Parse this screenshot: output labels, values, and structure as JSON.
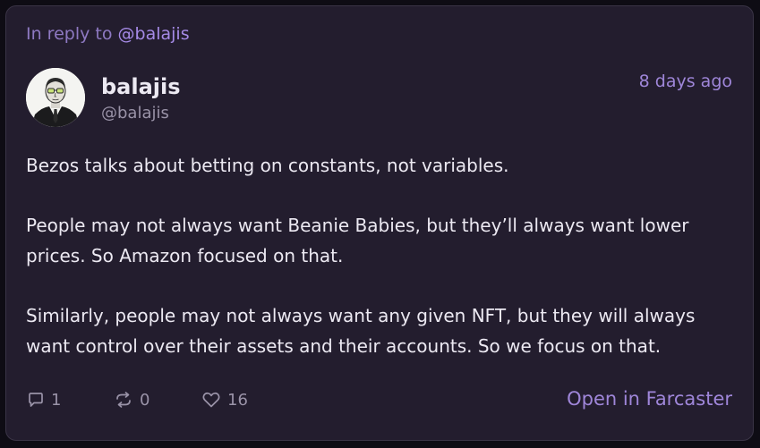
{
  "reply": {
    "prefix": "In reply to",
    "handle": "@balajis"
  },
  "author": {
    "display_name": "balajis",
    "handle": "@balajis",
    "avatar_icon": "portrait-avatar"
  },
  "post": {
    "timestamp": "8 days ago",
    "paragraphs": [
      [
        "Bezos talks about betting on constants, not variables."
      ],
      [
        "People may not always want Beanie Babies, but they’ll always want lower",
        "prices. So Amazon focused on that."
      ],
      [
        "Similarly, people may not always want any given NFT, but they will always",
        "want control over their assets and their accounts. So we focus on that."
      ]
    ]
  },
  "actions": {
    "replies": {
      "icon": "comment-icon",
      "count": "1"
    },
    "recasts": {
      "icon": "recast-icon",
      "count": "0"
    },
    "likes": {
      "icon": "heart-icon",
      "count": "16"
    },
    "open_label": "Open in Farcaster"
  },
  "colors": {
    "background": "#231d2e",
    "accent": "#9f86d9",
    "text": "#ece9f2",
    "muted": "#9a93a8"
  }
}
